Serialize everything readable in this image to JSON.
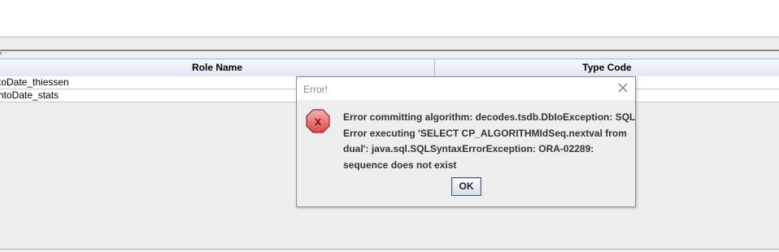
{
  "table": {
    "columns": [
      "Role Name",
      "Type Code"
    ],
    "rows": [
      {
        "role_name": "toDate_thiessen",
        "type_code": ""
      },
      {
        "role_name": "htoDate_stats",
        "type_code": ""
      }
    ]
  },
  "dialog": {
    "title": "Error!",
    "message_lines": [
      "Error committing algorithm: decodes.tsdb.DbIoException: SQL",
      "Error executing 'SELECT CP_ALGORITHMIdSeq.nextval from",
      "dual': java.sql.SQLSyntaxErrorException: ORA-02289:",
      "sequence does not exist"
    ],
    "icon": "error-x-icon",
    "icon_glyph": "x",
    "ok_label": "OK",
    "close_icon": "close-icon"
  },
  "colors": {
    "dialog_bg": "#eeeeee",
    "error_icon_fill": "#e46a6a",
    "error_icon_glyph": "#a01010",
    "header_bg": "#dfe8f3"
  }
}
